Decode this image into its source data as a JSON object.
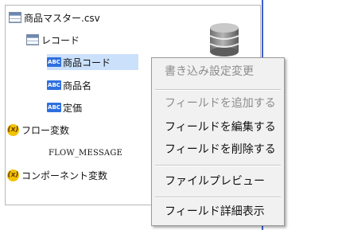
{
  "tree": {
    "root_label": "商品マスター.csv",
    "record_label": "レコード",
    "fields": [
      {
        "badge": "ABC",
        "label": "商品コード"
      },
      {
        "badge": "ABC",
        "label": "商品名"
      },
      {
        "badge": "ABC",
        "label": "定価"
      }
    ],
    "flow_var_badge": "(x)",
    "flow_var_label": "フロー変数",
    "flow_var_child": "FLOW_MESSAGE",
    "component_var_badge": "(x)",
    "component_var_label": "コンポーネント変数"
  },
  "context_menu": {
    "items": [
      {
        "label": "書き込み設定変更",
        "enabled": false
      },
      {
        "label": "フィールドを追加する",
        "enabled": false
      },
      {
        "label": "フィールドを編集する",
        "enabled": true
      },
      {
        "label": "フィールドを削除する",
        "enabled": true
      },
      {
        "label": "ファイルプレビュー",
        "enabled": true
      },
      {
        "label": "フィールド詳細表示",
        "enabled": true
      }
    ]
  },
  "colors": {
    "selection": "#cbe0fb",
    "accent_line": "#3b5fd8",
    "menu_bg": "#f1f1f1"
  }
}
